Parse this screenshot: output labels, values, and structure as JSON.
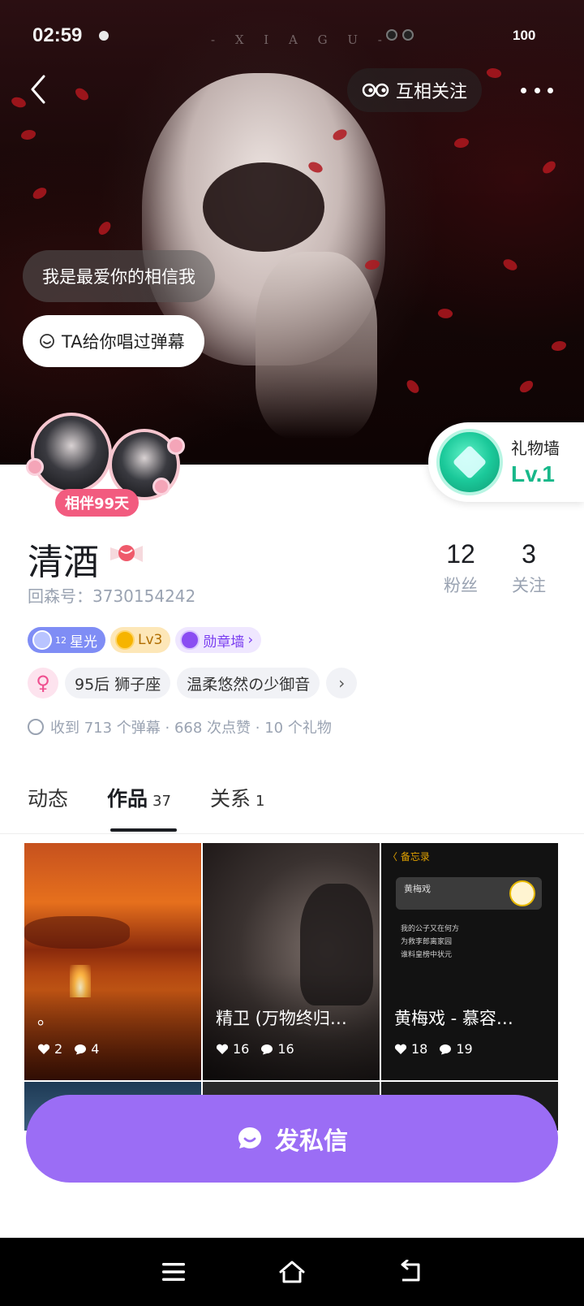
{
  "status_bar": {
    "time": "02:59",
    "battery": "100",
    "watermark": "- X I A G U -"
  },
  "header": {
    "back_icon": "chevron-left-icon",
    "mutual_follow_label": "互相关注",
    "mutual_icon": "mutual-eyes-icon",
    "more_icon": "more-dots-icon"
  },
  "banner": {
    "bubble_1": "我是最爱你的相信我",
    "bubble_2": "TA给你唱过弹幕",
    "bubble_2_icon": "smile-icon"
  },
  "profile": {
    "companion_label": "相伴99天",
    "name": "清酒",
    "name_badge_icon": "candy-icon",
    "id_label": "回森号：3730154242",
    "stats": {
      "fans_value": "12",
      "fans_label": "粉丝",
      "follow_value": "3",
      "follow_label": "关注"
    },
    "gift_wall": {
      "title": "礼物墙",
      "level": "Lv.1",
      "icon": "gem-star-icon"
    },
    "badges": {
      "star_label": "星光",
      "star_level": "12",
      "level_label": "Lv3",
      "medal_label": "勋章墙"
    },
    "tags": {
      "gender_symbol": "♀",
      "tag_1": "95后 狮子座",
      "tag_2": "温柔悠然の少御音",
      "more_symbol": "›"
    },
    "summary": "收到 713 个弹幕 · 668 次点赞 · 10 个礼物"
  },
  "tabs": {
    "dynamic": "动态",
    "works": "作品",
    "works_count": "37",
    "relations": "关系",
    "relations_count": "1"
  },
  "works": [
    {
      "title": "。",
      "likes": "2",
      "comments": "4"
    },
    {
      "title": "精卫 (万物终归…",
      "likes": "16",
      "comments": "16"
    },
    {
      "title": "黄梅戏 - 慕容…",
      "likes": "18",
      "comments": "19",
      "notes_header": "〈 备忘录",
      "player_title": "黄梅戏",
      "lyrics": [
        "我的公子又在何方",
        "为救李郎离家园",
        "谁料皇榜中状元"
      ]
    }
  ],
  "dm_button": {
    "label": "发私信",
    "icon": "chat-bubble-icon"
  },
  "navbar": {
    "menu_icon": "menu-icon",
    "home_icon": "home-icon",
    "back_icon": "back-arrow-icon"
  },
  "colors": {
    "accent_purple": "#9b6df5",
    "companion_pink": "#f25b7f",
    "gift_green": "#18b88a"
  }
}
